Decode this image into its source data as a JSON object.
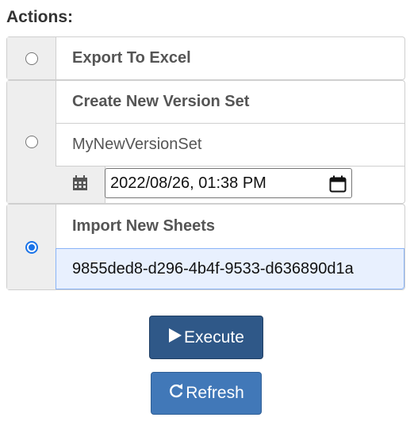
{
  "section_title": "Actions:",
  "actions": [
    {
      "label": "Export To Excel",
      "selected": false
    },
    {
      "label": "Create New Version Set",
      "selected": false,
      "version_name_value": "MyNewVersionSet",
      "datetime_value": "2022/08/26, 01:38 PM"
    },
    {
      "label": "Import New Sheets",
      "selected": true,
      "sheet_id_value": "9855ded8-d296-4b4f-9533-d636890d1a"
    }
  ],
  "buttons": {
    "execute": "Execute",
    "refresh": "Refresh"
  },
  "icons": {
    "calendar": "calendar-icon",
    "play": "play-icon",
    "refresh": "refresh-icon",
    "date_picker": "date-picker-icon"
  },
  "colors": {
    "primary_dark": "#2f5888",
    "primary": "#4178b8",
    "radio_checked": "#1a73e8",
    "input_focus_bg": "#e8f0fe"
  }
}
